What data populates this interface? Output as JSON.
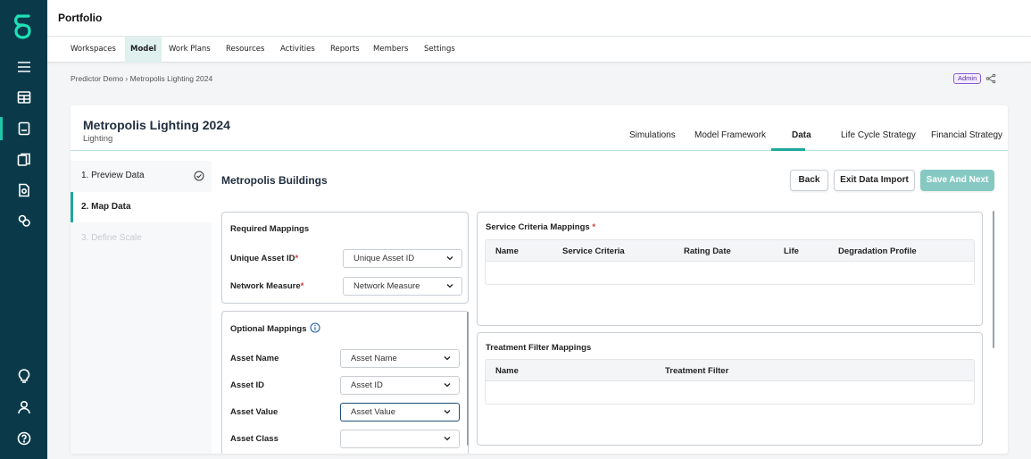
{
  "app": {
    "title": "Portfolio"
  },
  "nav": {
    "items": [
      "Workspaces",
      "Model",
      "Work Plans",
      "Resources",
      "Activities",
      "Reports",
      "Members",
      "Settings"
    ],
    "active": "Model"
  },
  "breadcrumb": {
    "path": "Predictor Demo › Metropolis Lighting 2024"
  },
  "role_badge": "Admin",
  "project": {
    "title": "Metropolis Lighting 2024",
    "subtitle": "Lighting"
  },
  "tabs": [
    "Simulations",
    "Model Framework",
    "Data",
    "Life Cycle Strategy",
    "Financial Strategy"
  ],
  "active_tab": "Data",
  "steps": [
    "1. Preview Data",
    "2. Map Data",
    "3. Define Scale"
  ],
  "section_title": "Metropolis Buildings",
  "buttons": {
    "back": "Back",
    "exit": "Exit Data Import",
    "save": "Save And Next"
  },
  "required": {
    "title": "Required Mappings",
    "unique_asset_id": {
      "label": "Unique Asset ID",
      "value": "Unique Asset ID"
    },
    "network_measure": {
      "label": "Network Measure",
      "value": "Network Measure"
    }
  },
  "optional": {
    "title": "Optional Mappings",
    "asset_name": {
      "label": "Asset Name",
      "value": "Asset Name"
    },
    "asset_id": {
      "label": "Asset ID",
      "value": "Asset ID"
    },
    "asset_value": {
      "label": "Asset Value",
      "value": "Asset Value"
    },
    "asset_class": {
      "label": "Asset Class",
      "value": ""
    }
  },
  "service_criteria": {
    "title": "Service Criteria Mappings",
    "columns": [
      "Name",
      "Service Criteria",
      "Rating Date",
      "Life",
      "Degradation Profile"
    ]
  },
  "treatment_filter": {
    "title": "Treatment Filter Mappings",
    "columns": [
      "Name",
      "Treatment Filter"
    ]
  },
  "colors": {
    "sidebar": "#0a3a4a",
    "accent": "#1fa89b",
    "primary_button": "#86c9c3"
  }
}
